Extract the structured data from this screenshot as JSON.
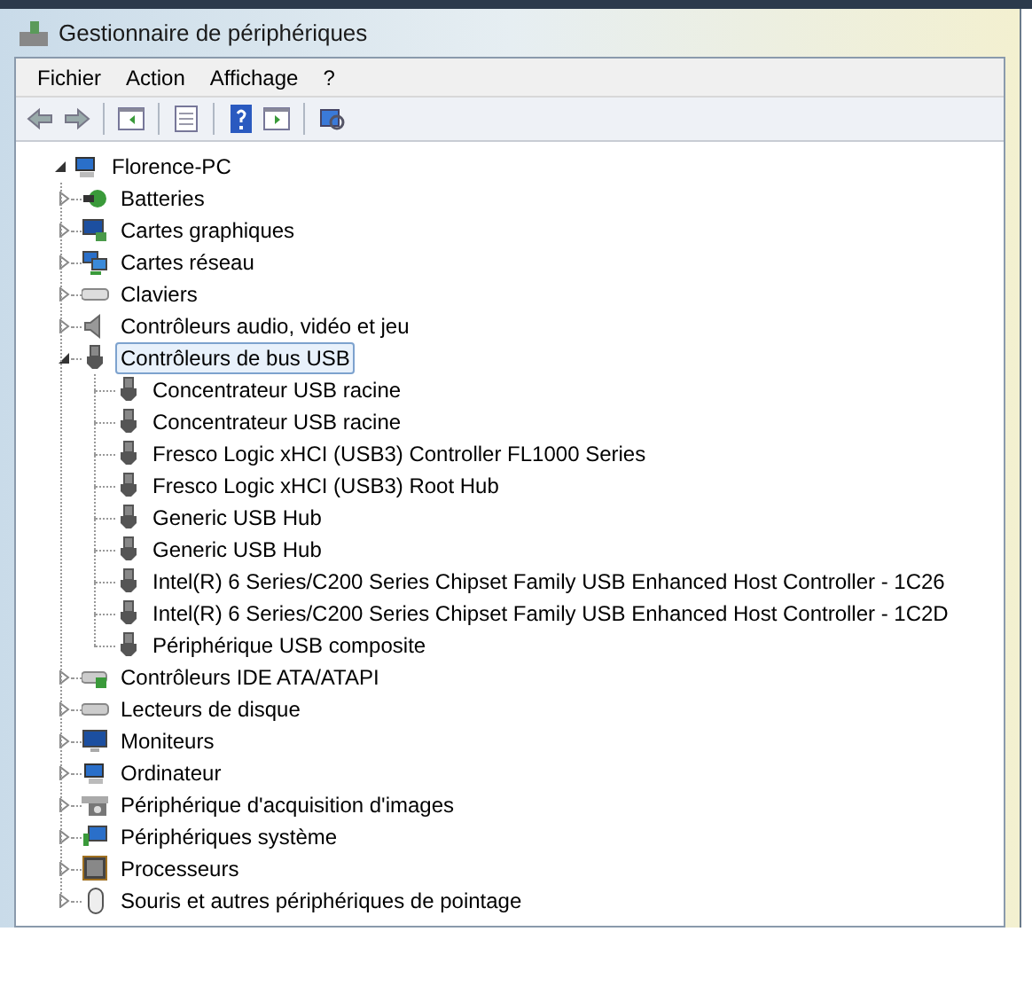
{
  "window": {
    "title": "Gestionnaire de périphériques"
  },
  "menu": [
    "Fichier",
    "Action",
    "Affichage",
    "?"
  ],
  "tree": {
    "label": "Florence-PC",
    "kind": "computer",
    "expanded": true,
    "selected": false,
    "children": [
      {
        "label": "Batteries",
        "kind": "battery",
        "expanded": false,
        "selected": false
      },
      {
        "label": "Cartes graphiques",
        "kind": "display",
        "expanded": false,
        "selected": false
      },
      {
        "label": "Cartes réseau",
        "kind": "network",
        "expanded": false,
        "selected": false
      },
      {
        "label": "Claviers",
        "kind": "keyboard",
        "expanded": false,
        "selected": false
      },
      {
        "label": "Contrôleurs audio, vidéo et jeu",
        "kind": "speaker",
        "expanded": false,
        "selected": false
      },
      {
        "label": "Contrôleurs de bus USB",
        "kind": "usb",
        "expanded": true,
        "selected": true,
        "children": [
          {
            "label": "Concentrateur USB racine",
            "kind": "usb",
            "selected": false
          },
          {
            "label": "Concentrateur USB racine",
            "kind": "usb",
            "selected": false
          },
          {
            "label": "Fresco Logic xHCI (USB3) Controller FL1000 Series",
            "kind": "usb",
            "selected": false
          },
          {
            "label": "Fresco Logic xHCI (USB3) Root Hub",
            "kind": "usb",
            "selected": false
          },
          {
            "label": "Generic USB Hub",
            "kind": "usb",
            "selected": false
          },
          {
            "label": "Generic USB Hub",
            "kind": "usb",
            "selected": false
          },
          {
            "label": "Intel(R) 6 Series/C200 Series Chipset Family USB Enhanced Host Controller - 1C26",
            "kind": "usb",
            "selected": false
          },
          {
            "label": "Intel(R) 6 Series/C200 Series Chipset Family USB Enhanced Host Controller - 1C2D",
            "kind": "usb",
            "selected": false
          },
          {
            "label": "Périphérique USB composite",
            "kind": "usb",
            "selected": false
          }
        ]
      },
      {
        "label": "Contrôleurs IDE ATA/ATAPI",
        "kind": "ide",
        "expanded": false,
        "selected": false
      },
      {
        "label": "Lecteurs de disque",
        "kind": "disk",
        "expanded": false,
        "selected": false
      },
      {
        "label": "Moniteurs",
        "kind": "monitor",
        "expanded": false,
        "selected": false
      },
      {
        "label": "Ordinateur",
        "kind": "computer",
        "expanded": false,
        "selected": false
      },
      {
        "label": "Périphérique d'acquisition d'images",
        "kind": "camera",
        "expanded": false,
        "selected": false
      },
      {
        "label": "Périphériques système",
        "kind": "system",
        "expanded": false,
        "selected": false
      },
      {
        "label": "Processeurs",
        "kind": "cpu",
        "expanded": false,
        "selected": false
      },
      {
        "label": "Souris et autres périphériques de pointage",
        "kind": "mouse",
        "expanded": false,
        "selected": false
      }
    ]
  }
}
